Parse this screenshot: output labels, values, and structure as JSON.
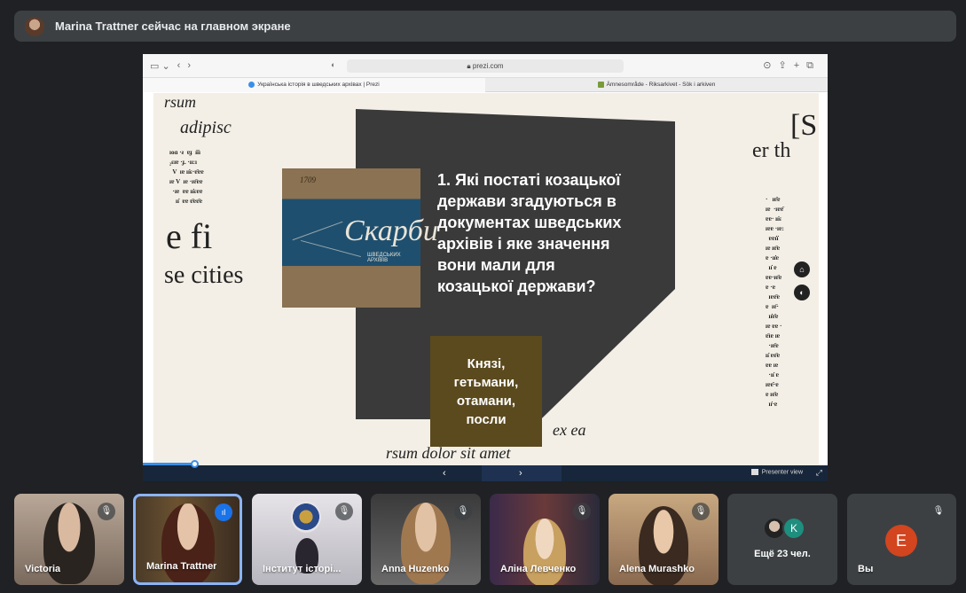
{
  "banner": {
    "text": "Marina Trattner сейчас на главном экране"
  },
  "browser": {
    "url": "prezi.com",
    "tabs": [
      {
        "label": "Українська історія в шведських архівах | Prezi"
      },
      {
        "label": "Ämnesområde - Riksarkivet - Sök i arkiven"
      }
    ]
  },
  "slide": {
    "question": "1. Які постаті козацької\nдержави згадуються в\nдокументах шведських\nархівів і яке значення\nвони мали для\nкозацької держави?",
    "answer": "Князі,\nгетьмани,\nотамани,\nпосли",
    "book_title": "Скарби",
    "book_subtitle": "ШВЕДСЬКИХ АРХІВІВ",
    "book_year": "1709",
    "bg_words": {
      "w1": "rsum",
      "w2": "adipisc",
      "w3": "e fi",
      "w4": "se cities",
      "w5": "er th",
      "w6": "ex ea",
      "w7": "rsum dolor sit amet",
      "w8": "[S"
    }
  },
  "player": {
    "presenter_label": "Presenter view",
    "progress": 0.075
  },
  "participants": [
    {
      "name": "Victoria",
      "muted": true
    },
    {
      "name": "Marina Trattner",
      "muted": false,
      "speaking": true
    },
    {
      "name": "Інститут історі...",
      "muted": true
    },
    {
      "name": "Anna Huzenko",
      "muted": true
    },
    {
      "name": "Аліна Левченко",
      "muted": true
    },
    {
      "name": "Alena Murashko",
      "muted": true
    }
  ],
  "more": {
    "label": "Ещё 23 чел.",
    "avatar_letter": "K"
  },
  "self": {
    "name": "Вы",
    "initial": "E"
  },
  "colors": {
    "accent": "#8ab4f8",
    "panel": "#3a3a3a",
    "answer_box": "#5b4a1e",
    "self_avatar": "#d2451e"
  }
}
